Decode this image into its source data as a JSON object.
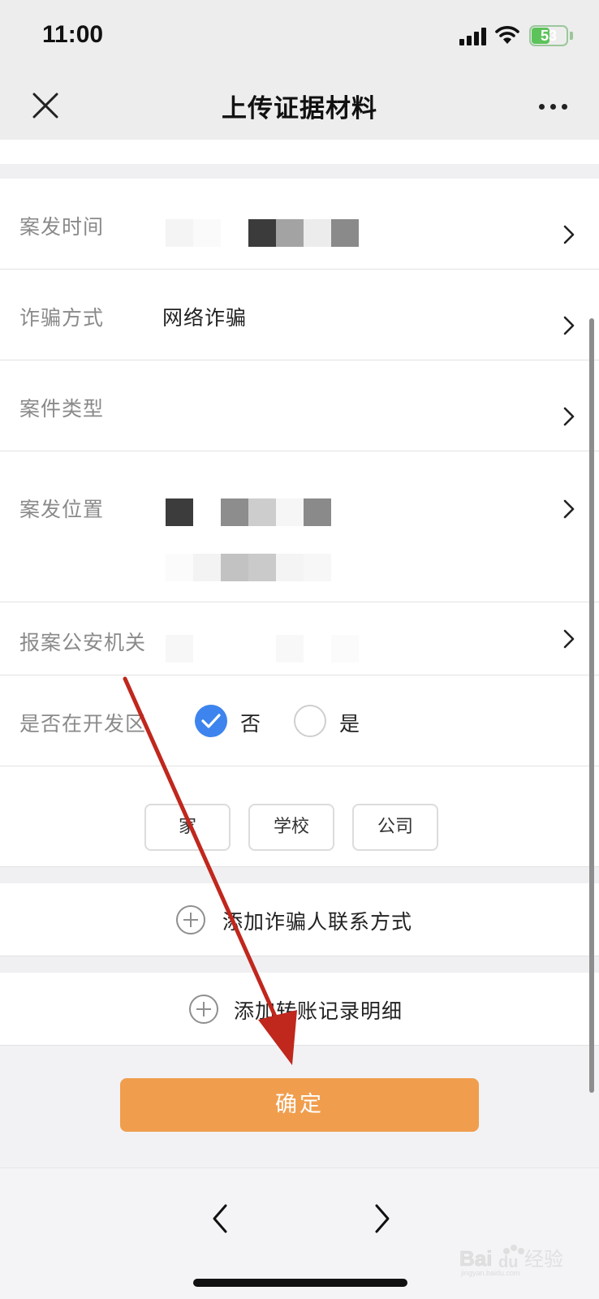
{
  "status_bar": {
    "time": "11:00",
    "battery": "53",
    "battery_level": 0.53
  },
  "header": {
    "title": "上传证据材料"
  },
  "form": {
    "rows": [
      {
        "label": "案发时间",
        "value": ""
      },
      {
        "label": "诈骗方式",
        "value": "网络诈骗"
      },
      {
        "label": "案件类型",
        "value": ""
      },
      {
        "label": "案发位置",
        "value": ""
      },
      {
        "label": "报案公安机关",
        "value": ""
      },
      {
        "label": "是否在开发区"
      }
    ],
    "radio": {
      "option_no": "否",
      "option_yes": "是",
      "selected": "否"
    },
    "chips": [
      "家",
      "学校",
      "公司"
    ]
  },
  "actions": {
    "add_contact": "添加诈骗人联系方式",
    "add_transfer": "添加转账记录明细",
    "confirm": "确定"
  },
  "colors": {
    "accent_blue": "#3d84ee",
    "confirm_orange": "#f09e4e",
    "annotation_arrow": "#c0271d",
    "battery_green": "#5cc35a"
  },
  "icons": [
    "close-icon",
    "more-icon",
    "chevron-right-icon",
    "check-icon",
    "plus-circle-icon",
    "back-icon",
    "forward-icon",
    "wifi-icon",
    "signal-icon",
    "battery-icon"
  ]
}
